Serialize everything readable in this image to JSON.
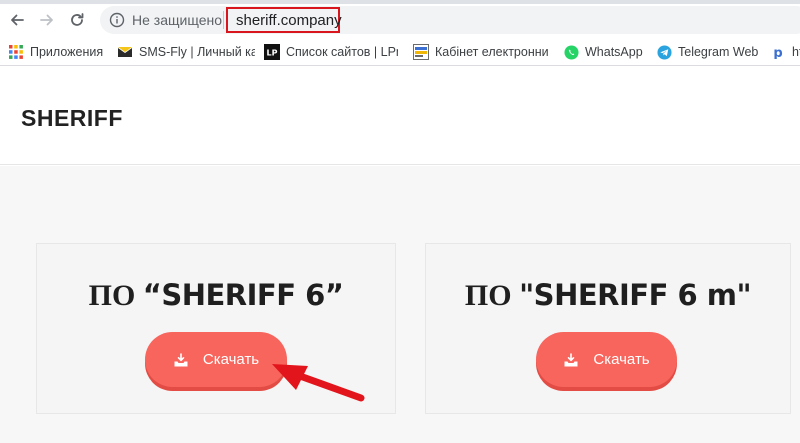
{
  "browser": {
    "security_label": "Не защищено",
    "url": "sheriff.company",
    "accent_color": "#d9151d"
  },
  "bookmarks": [
    {
      "icon": "apps-grid-icon",
      "label": "Приложения"
    },
    {
      "icon": "sms-fly-icon",
      "label": "SMS-Fly | Личный ка"
    },
    {
      "icon": "lp-icon",
      "label": "Список сайтов | LPm"
    },
    {
      "icon": "kep-icon",
      "label": "Кабінет електронни"
    },
    {
      "icon": "whatsapp-icon",
      "label": "WhatsApp"
    },
    {
      "icon": "telegram-icon",
      "label": "Telegram Web"
    },
    {
      "icon": "p-icon",
      "label": "ht"
    }
  ],
  "site": {
    "logo": "SHERIFF"
  },
  "cards": [
    {
      "title_prefix": "ПО ",
      "title_name": "“SHERIFF 6”",
      "button_label": "Скачать"
    },
    {
      "title_prefix": "ПО ",
      "title_name": "\"SHERIFF 6 m\"",
      "button_label": "Скачать"
    }
  ],
  "colors": {
    "button": "#f7655d",
    "annotation_arrow": "#e3151c"
  }
}
